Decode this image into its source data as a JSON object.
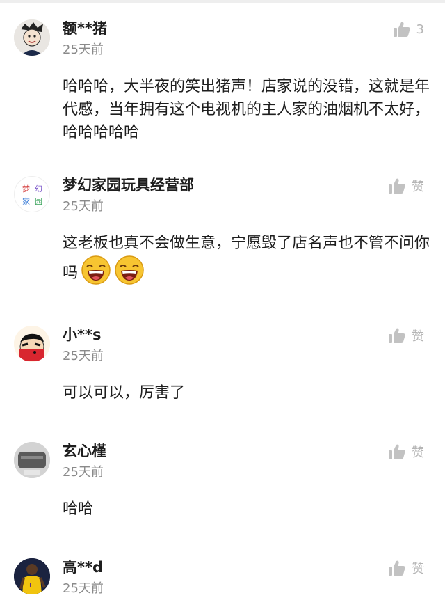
{
  "comments": [
    {
      "username": "额**猪",
      "time": "25天前",
      "like_label": "3",
      "text": "哈哈哈，大半夜的笑出猪声！店家说的没错，这就是年代感，当年拥有这个电视机的主人家的油烟机不太好，哈哈哈哈哈",
      "avatar_icon": "cartoon-person-avatar"
    },
    {
      "username": "梦幻家园玩具经营部",
      "time": "25天前",
      "like_label": "赞",
      "text": "这老板也真不会做生意，宁愿毁了店名声也不管不问你吗",
      "avatar_icon": "shop-logo-avatar",
      "avatar_text": [
        "梦",
        "幻",
        "家",
        "园"
      ],
      "emojis": [
        "laughing-emoji",
        "laughing-emoji"
      ]
    },
    {
      "username": "小**s",
      "time": "25天前",
      "like_label": "赞",
      "text": "可以可以，厉害了",
      "avatar_icon": "crayon-shinchan-avatar"
    },
    {
      "username": "玄心槿",
      "time": "25天前",
      "like_label": "赞",
      "text": "哈哈",
      "avatar_icon": "photo-avatar"
    },
    {
      "username": "高**d",
      "time": "25天前",
      "like_label": "赞",
      "text": "",
      "avatar_icon": "basketball-player-avatar"
    }
  ],
  "colors": {
    "username": "#1e1e1e",
    "time": "#8a8a8a",
    "like_icon": "#b5b5b5",
    "text": "#1e1e1e"
  }
}
